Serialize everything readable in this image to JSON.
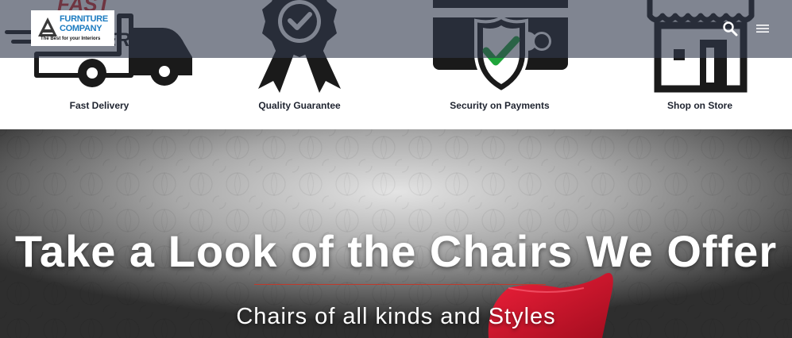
{
  "header": {
    "logo_line1": "Furniture",
    "logo_line2": "Company",
    "logo_tagline": "The Best for your Interiors",
    "search_icon": "search-icon",
    "menu_icon": "hamburger-menu-icon"
  },
  "features": [
    {
      "label": "Fast Delivery",
      "icon": "delivery-truck-icon",
      "art_text": "FAST DELIVERY"
    },
    {
      "label": "Quality Guarantee",
      "icon": "award-ribbon-icon"
    },
    {
      "label": "Security on Payments",
      "icon": "secure-card-shield-icon"
    },
    {
      "label": "Shop on Store",
      "icon": "storefront-icon"
    }
  ],
  "hero": {
    "title": "Take a Look of the Chairs We Offer",
    "subtitle": "Chairs of all kinds and Styles"
  },
  "colors": {
    "header_overlay": "#323a4e",
    "logo_blue": "#1b7bc0",
    "accent_red": "#c0392b",
    "check_green": "#1fa53a",
    "chair_red": "#d8142c"
  }
}
